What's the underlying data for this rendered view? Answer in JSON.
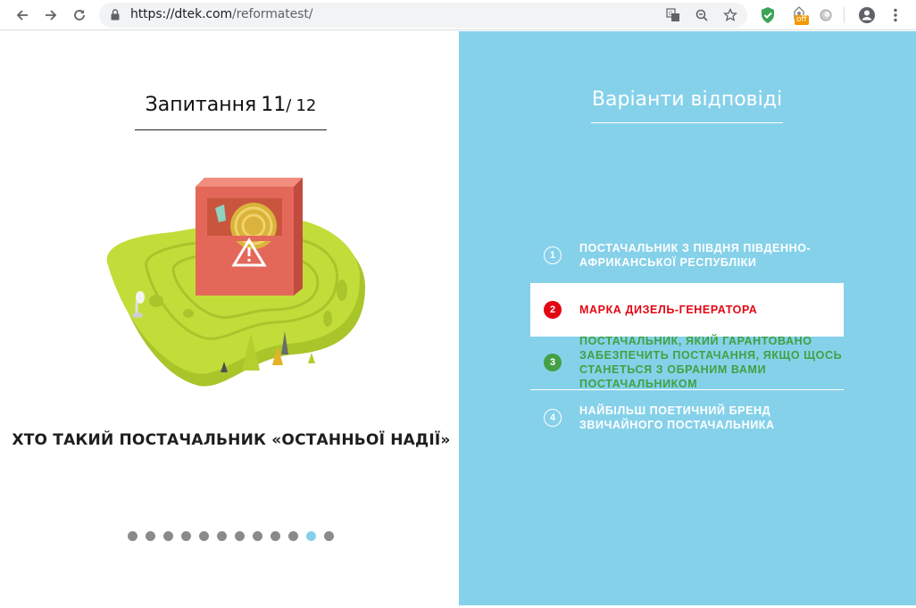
{
  "browser": {
    "url_host": "https://dtek.com",
    "url_path": "/reformatest/",
    "ext_badge": "off",
    "icons": [
      "back-icon",
      "forward-icon",
      "reload-icon",
      "lock-icon",
      "translate-icon",
      "zoom-icon",
      "star-icon",
      "shield-extension-icon",
      "extension-icon",
      "circle-extension-icon",
      "account-icon",
      "menu-icon"
    ]
  },
  "quiz": {
    "title_prefix": "Запитання",
    "current": "11",
    "separator": "/",
    "total": "12",
    "question": "ХТО ТАКИЙ ПОСТАЧАЛЬНИК «ОСТАННЬОЇ НАДІЇ»",
    "progress": {
      "count": 12,
      "active_index": 10
    }
  },
  "answers": {
    "title": "Варіанти відповіді",
    "options": [
      {
        "num": "1",
        "text": "ПОСТАЧАЛЬНИК З ПІВДНЯ ПІВДЕННО-АФРИКАНСЬКОЇ РЕСПУБЛІКИ",
        "state": "default"
      },
      {
        "num": "2",
        "text": "МАРКА ДИЗЕЛЬ-ГЕНЕРАТОРА",
        "state": "wrong"
      },
      {
        "num": "3",
        "text": "ПОСТАЧАЛЬНИК, ЯКИЙ ГАРАНТОВАНО ЗАБЕЗПЕЧИТЬ ПОСТАЧАННЯ, ЯКЩО ЩОСЬ СТАНЕТЬСЯ З ОБРАНИМ ВАМИ ПОСТАЧАЛЬНИКОМ",
        "state": "correct"
      },
      {
        "num": "4",
        "text": "НАЙБІЛЬШ ПОЕТИЧНИЙ БРЕНД ЗВИЧАЙНОГО ПОСТАЧАЛЬНИКА",
        "state": "default"
      }
    ]
  },
  "colors": {
    "accent_blue": "#86d1ea",
    "wrong_red": "#e30613",
    "correct_green": "#44a045"
  }
}
